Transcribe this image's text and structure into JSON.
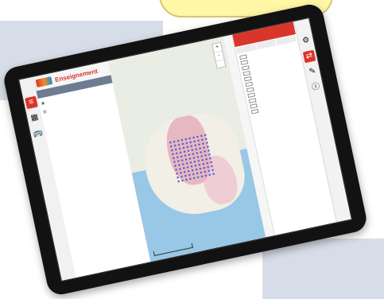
{
  "bubble": {
    "text": ""
  },
  "app": {
    "title": "Enseignement"
  },
  "left_panel": {
    "header": "",
    "items": [
      "",
      ""
    ]
  },
  "right_panel": {
    "header": "",
    "sections": [
      "",
      "",
      "",
      "",
      "",
      "",
      "",
      "",
      "",
      "",
      ""
    ]
  },
  "map": {
    "labels": [
      "",
      "",
      "",
      ""
    ],
    "zoom_in": "+",
    "zoom_out": "-"
  },
  "icons": {
    "left_rail": [
      "list-icon",
      "layers-icon",
      "bus-icon"
    ],
    "right_rail": [
      "settings-icon",
      "share-icon",
      "ruler-icon",
      "info-icon"
    ]
  },
  "colors": {
    "accent": "#d9362b",
    "water": "#99c7e6",
    "overlay": "#db7696",
    "points": "#3c55c5"
  }
}
